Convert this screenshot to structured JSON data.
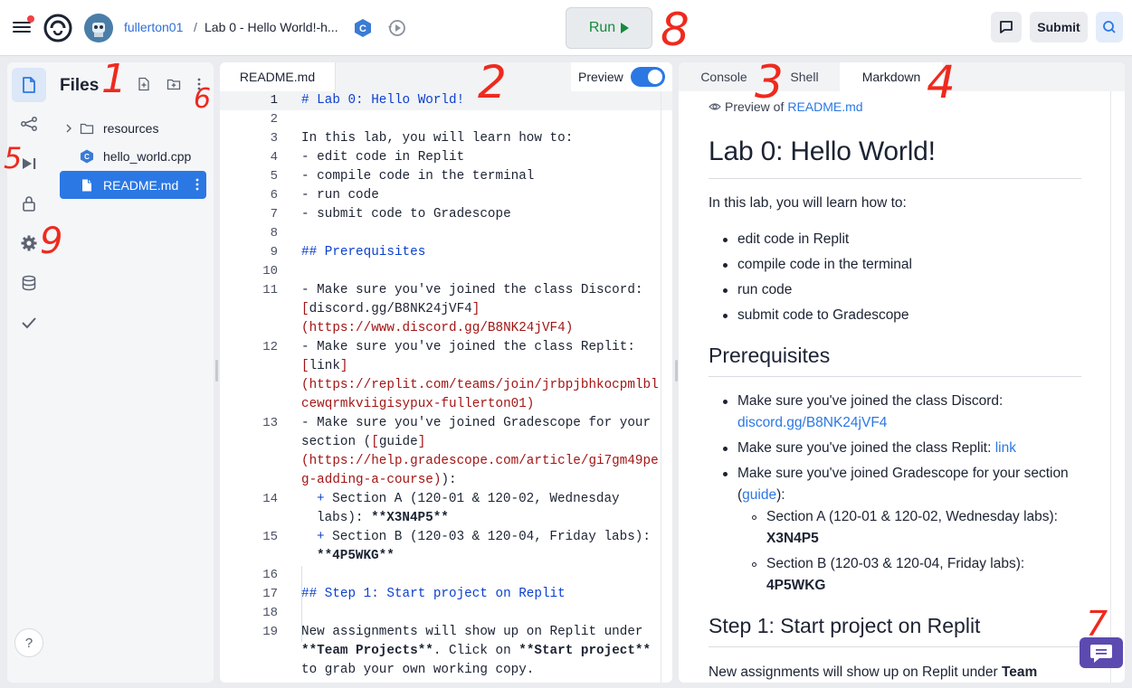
{
  "topbar": {
    "username": "fullerton01",
    "separator": "/",
    "repl_name": "Lab 0 - Hello World!-h...",
    "run_label": "Run",
    "submit_label": "Submit"
  },
  "files": {
    "title": "Files",
    "items": [
      {
        "label": "resources",
        "type": "folder"
      },
      {
        "label": "hello_world.cpp",
        "type": "cpp-file"
      },
      {
        "label": "README.md",
        "type": "file"
      }
    ]
  },
  "editor": {
    "tab_label": "README.md",
    "preview_label": "Preview",
    "line_numbers": [
      "1",
      "2",
      "3",
      "4",
      "5",
      "6",
      "7",
      "8",
      "9",
      "10",
      "11",
      "12",
      "13",
      "14",
      "15",
      "16",
      "17",
      "18",
      "19"
    ],
    "lines": {
      "l1": "# Lab 0: Hello World!",
      "l3": "In this lab, you will learn how to:",
      "l4": "- edit code in Replit",
      "l5": "- compile code in the terminal",
      "l6": "- run code",
      "l7": "- submit code to Gradescope",
      "l9": "## Prerequisites",
      "l11a": "- Make sure you've joined the class Discord:",
      "l11b_open": "[",
      "l11b_text": "discord.gg/B8NK24jVF4",
      "l11b_close": "]",
      "l11c": "(https://www.discord.gg/B8NK24jVF4)",
      "l12a": "- Make sure you've joined the class Replit:",
      "l12b_open": "[",
      "l12b_text": "link",
      "l12b_close": "]",
      "l12c": "(https://replit.com/teams/join/jrbpjbhkocpmlbl",
      "l12d": "cewqrmkviigisypux-fullerton01)",
      "l13a": "- Make sure you've joined Gradescope for your",
      "l13b_pre": "section (",
      "l13b_open": "[",
      "l13b_text": "guide",
      "l13b_close": "]",
      "l13c": "(https://help.gradescope.com/article/gi7gm49pe",
      "l13d_link": "g-adding-a-course)",
      "l13d_rest": "):",
      "l14a_plus": "+",
      "l14a": " Section A (120-01 & 120-02, Wednesday",
      "l14b_pre": "labs): ",
      "l14b_bold": "**X3N4P5**",
      "l15a_plus": "+",
      "l15a": " Section B (120-03 & 120-04, Friday labs):",
      "l15b_bold": "**4P5WKG**",
      "l17": "## Step 1: Start project on Replit",
      "l19a": "New assignments will show up on Replit under",
      "l19b_bold1": "**Team Projects**",
      "l19b_mid": ". Click on ",
      "l19b_bold2": "**Start project**",
      "l19c": "to grab your own working copy."
    }
  },
  "right_panel": {
    "tabs": [
      "Console",
      "Shell",
      "Markdown"
    ],
    "active_tab": "Markdown",
    "preview_of": "Preview of",
    "preview_file": "README.md",
    "h1": "Lab 0: Hello World!",
    "intro": "In this lab, you will learn how to:",
    "learn_items": [
      "edit code in Replit",
      "compile code in the terminal",
      "run code",
      "submit code to Gradescope"
    ],
    "prereq_heading": "Prerequisites",
    "discord_text": "Make sure you've joined the class Discord:",
    "discord_link": "discord.gg/B8NK24jVF4",
    "replit_text": "Make sure you've joined the class Replit: ",
    "replit_link": "link",
    "gradescope_text": "Make sure you've joined Gradescope for your section",
    "gradescope_open": "(",
    "gradescope_link": "guide",
    "gradescope_close": "):",
    "section_a_text": "Section A (120-01 & 120-02, Wednesday labs):",
    "section_a_code": "X3N4P5",
    "section_b_text": "Section B (120-03 & 120-04, Friday labs):",
    "section_b_code": "4P5WKG",
    "step1_heading": "Step 1: Start project on Replit",
    "step1_text_pre": "New assignments will show up on Replit under ",
    "step1_text_bold": "Team"
  },
  "help_label": "?",
  "annotations": [
    "1",
    "2",
    "3",
    "4",
    "5",
    "6",
    "7",
    "8",
    "9"
  ],
  "colors": {
    "accent": "#2b78e4",
    "run_green": "#148b3c",
    "annotation_red": "#ee2a1e",
    "support_purple": "#5c4ab0"
  }
}
